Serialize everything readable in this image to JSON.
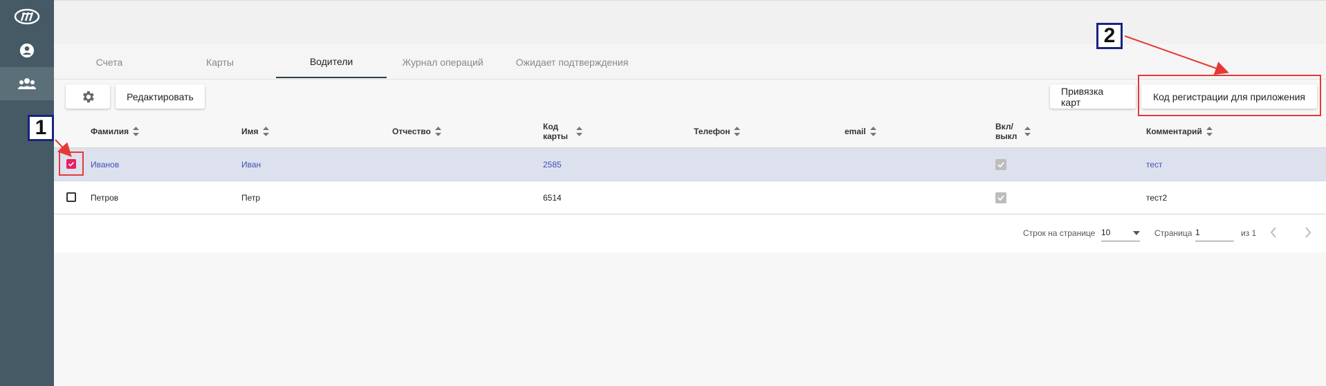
{
  "tabs": [
    {
      "label": "Счета"
    },
    {
      "label": "Карты"
    },
    {
      "label": "Водители"
    },
    {
      "label": "Журнал операций"
    },
    {
      "label": "Ожидает подтверждения"
    }
  ],
  "active_tab": "Водители",
  "toolbar": {
    "edit_label": "Редактировать",
    "bind_cards_label": "Привязка карт",
    "reg_code_label": "Код регистрации для приложения"
  },
  "table": {
    "columns": [
      {
        "label": "Фамилия"
      },
      {
        "label": "Имя"
      },
      {
        "label": "Отчество"
      },
      {
        "label": "Код карты"
      },
      {
        "label": "Телефон"
      },
      {
        "label": "email"
      },
      {
        "label": "Вкл/ выкл"
      },
      {
        "label": "Комментарий"
      }
    ],
    "rows": [
      {
        "last_name": "Иванов",
        "first_name": "Иван",
        "middle_name": "",
        "card_code": "2585",
        "phone": "",
        "email": "",
        "enabled": true,
        "comment": "тест",
        "selected": true
      },
      {
        "last_name": "Петров",
        "first_name": "Петр",
        "middle_name": "",
        "card_code": "6514",
        "phone": "",
        "email": "",
        "enabled": true,
        "comment": "тест2",
        "selected": false
      }
    ]
  },
  "pagination": {
    "rows_per_page_label": "Строк на странице",
    "rows_per_page_value": "10",
    "page_label": "Страница",
    "page_value": "1",
    "of_label": "из 1"
  },
  "annotations": {
    "badge_1": "1",
    "badge_2": "2"
  },
  "colors": {
    "sidebar": "#455a64",
    "selected_row": "#dde1ee",
    "selected_text": "#3f51b5",
    "checkbox_checked": "#e91e63",
    "annotation_red": "#e53935",
    "badge_border": "#1a237e"
  },
  "icons": {
    "logo": "brand-logo-icon",
    "user": "account-circle-icon",
    "group": "group-icon",
    "settings": "gear-icon"
  }
}
